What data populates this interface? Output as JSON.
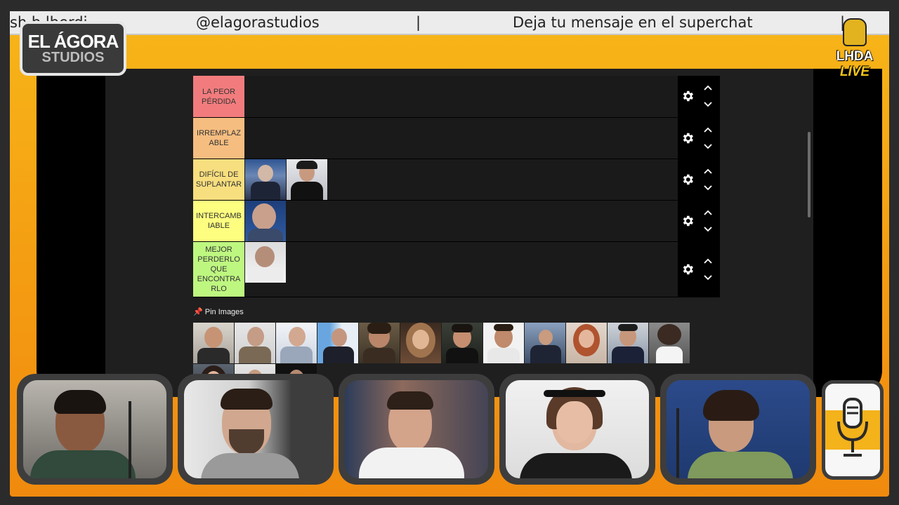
{
  "ticker": {
    "segment_left": "sh    b    lberdi   -",
    "handle": "@elagorastudios",
    "separator": "|",
    "message": "Deja tu mensaje en el superchat",
    "separator_right": "|"
  },
  "logos": {
    "agora_line1": "EL ÁGORA",
    "agora_line2": "STUDIOS",
    "live_line1": "LHDA",
    "live_line2": "LIVE"
  },
  "tiers": [
    {
      "label": "LA PEOR PÉRDIDA",
      "color": "#f27c7d"
    },
    {
      "label": "IRREMPLAZ ABLE",
      "color": "#f6bd80"
    },
    {
      "label": "DIFÍCIL DE SUPLANTAR",
      "color": "#f7de7e"
    },
    {
      "label": "INTERCAMB IABLE",
      "color": "#fdfe7f"
    },
    {
      "label": "MEJOR PERDERLO QUE ENCONTRA RLO",
      "color": "#bef780"
    }
  ],
  "pin_images_label": "Pin Images",
  "icons": {
    "settings": "gear-icon",
    "move_up": "chevron-up-icon",
    "move_down": "chevron-down-icon",
    "pin": "pin-icon",
    "microphone_badge": "microphone-icon"
  },
  "colors": {
    "frame_orange": "#f49b12",
    "page_bg": "#1f1f1f",
    "ticker_bg": "#ececec"
  }
}
